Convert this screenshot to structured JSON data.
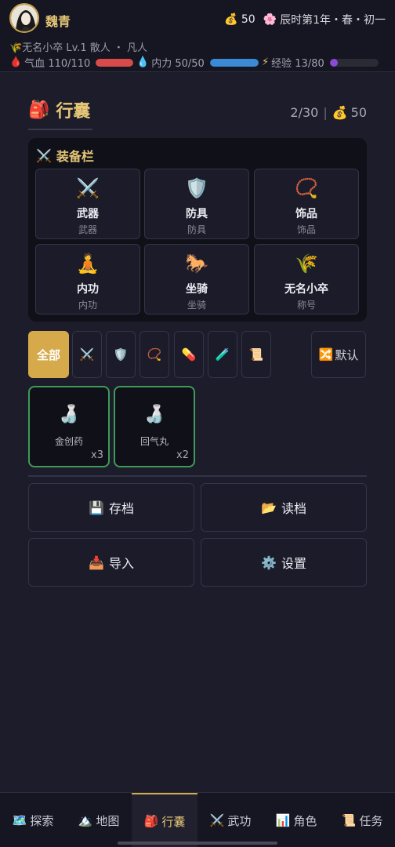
{
  "header": {
    "name": "魏青",
    "gold_icon": "money-bag-icon",
    "gold": "50",
    "time_icon": "flower-icon",
    "time": "辰时第1年・春・初一",
    "title_icon": "wheat-icon",
    "subtitle": "无名小卒 Lv.1 散人 ・ 凡人",
    "stats": [
      {
        "icon": "blood-drop-icon",
        "label": "气血 110/110",
        "fraction": 1.0,
        "color": "#d94a4a"
      },
      {
        "icon": "water-drop-icon",
        "label": "内力 50/50",
        "fraction": 1.0,
        "color": "#3a8ad6"
      },
      {
        "icon": "lightning-icon",
        "label": "经验 13/80",
        "fraction": 0.1625,
        "color": "#8a4ad6"
      }
    ]
  },
  "inventory": {
    "title": "行囊",
    "title_icon": "backpack-icon",
    "capacity": "2/30",
    "gold": "50",
    "equipment": {
      "title": "装备栏",
      "title_icon": "crossed-swords-icon",
      "slots": [
        {
          "icon": "crossed-swords-icon",
          "label": "武器",
          "sub": "武器"
        },
        {
          "icon": "shield-icon",
          "label": "防具",
          "sub": "防具"
        },
        {
          "icon": "prayer-beads-icon",
          "label": "饰品",
          "sub": "饰品"
        },
        {
          "icon": "meditation-icon",
          "label": "内功",
          "sub": "内功"
        },
        {
          "icon": "horse-icon",
          "label": "坐骑",
          "sub": "坐骑"
        },
        {
          "icon": "wheat-icon",
          "label": "无名小卒",
          "sub": "称号"
        }
      ]
    },
    "filters": [
      {
        "label": "全部",
        "active": true
      },
      {
        "icon": "crossed-swords-icon"
      },
      {
        "icon": "shield-icon"
      },
      {
        "icon": "prayer-beads-icon"
      },
      {
        "icon": "pill-icon"
      },
      {
        "icon": "test-tube-icon"
      },
      {
        "icon": "scroll-icon"
      }
    ],
    "sort_button": "默认",
    "sort_icon": "shuffle-icon",
    "items": [
      {
        "icon": "potion-jar-icon",
        "label": "金创药",
        "count": "x3"
      },
      {
        "icon": "potion-jar-icon",
        "label": "回气丸",
        "count": "x2"
      }
    ]
  },
  "actions": [
    {
      "icon": "floppy-disk-icon",
      "label": "存档"
    },
    {
      "icon": "open-folder-icon",
      "label": "读档"
    },
    {
      "icon": "inbox-tray-icon",
      "label": "导入"
    },
    {
      "icon": "gear-icon",
      "label": "设置"
    }
  ],
  "nav": [
    {
      "icon": "map-icon",
      "label": "探索",
      "active": false
    },
    {
      "icon": "mountain-icon",
      "label": "地图",
      "active": false
    },
    {
      "icon": "backpack-icon",
      "label": "行囊",
      "active": true
    },
    {
      "icon": "crossed-swords-icon",
      "label": "武功",
      "active": false
    },
    {
      "icon": "bar-chart-icon",
      "label": "角色",
      "active": false
    },
    {
      "icon": "scroll-icon",
      "label": "任务",
      "active": false
    }
  ]
}
